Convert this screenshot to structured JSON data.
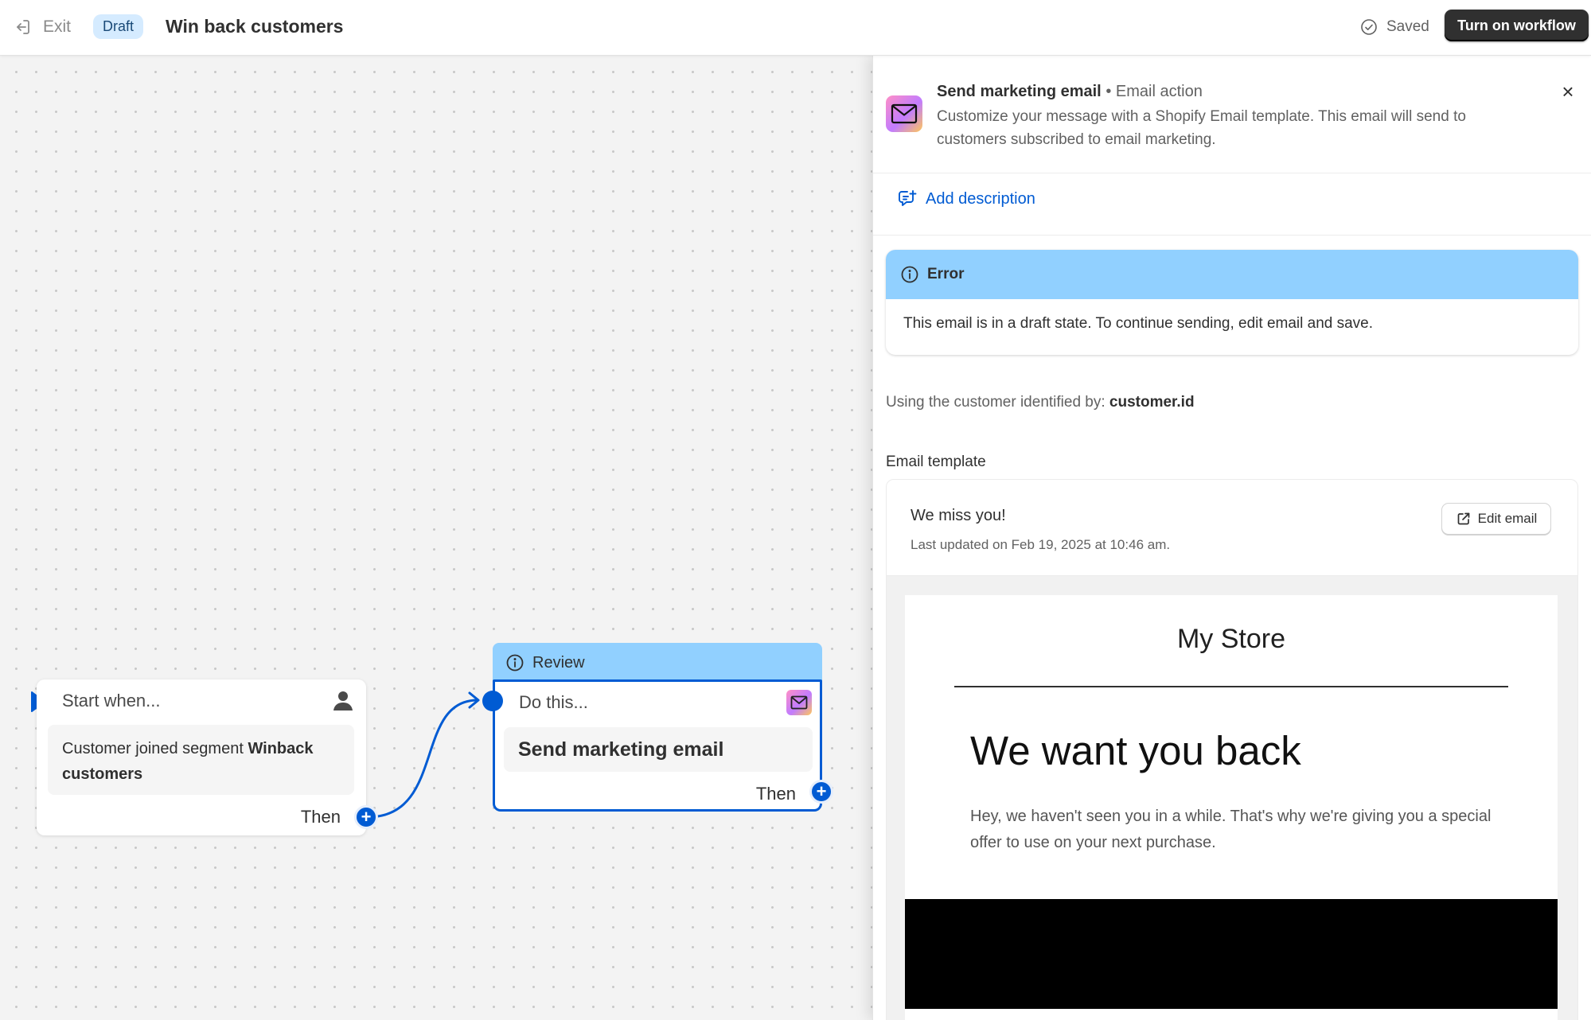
{
  "header": {
    "exit_label": "Exit",
    "status_badge": "Draft",
    "title": "Win back customers",
    "saved_label": "Saved",
    "primary_button": "Turn on workflow"
  },
  "canvas": {
    "trigger": {
      "heading": "Start when...",
      "body_prefix": "Customer joined segment ",
      "body_segment": "Winback customers",
      "then_label": "Then"
    },
    "action": {
      "status_label": "Review",
      "heading": "Do this...",
      "body": "Send marketing email",
      "then_label": "Then"
    }
  },
  "panel": {
    "title": "Send marketing email",
    "separator": "•",
    "kind": "Email action",
    "description": "Customize your message with a Shopify Email template. This email will send to customers subscribed to email marketing.",
    "add_description_label": "Add description",
    "error": {
      "title": "Error",
      "message": "This email is in a draft state. To continue sending, edit email and save."
    },
    "customer_prefix": "Using the customer identified by: ",
    "customer_field": "customer.id",
    "template_label": "Email template",
    "template": {
      "name": "We miss you!",
      "updated": "Last updated on Feb 19, 2025 at 10:46 am.",
      "edit_label": "Edit email"
    },
    "preview": {
      "store_name": "My Store",
      "headline": "We want you back",
      "body": "Hey, we haven't seen you in a while. That's why we're giving you a special offer to use on your next purchase."
    },
    "close_glyph": "×"
  },
  "colors": {
    "accent": "#005bd3",
    "status_info": "#91d0ff",
    "primary_button_bg": "#303030",
    "badge_bg": "#d5ebff"
  },
  "icons": [
    "exit-icon",
    "check-circle-icon",
    "person-icon",
    "mail-icon",
    "info-icon",
    "add-description-icon",
    "external-link-icon",
    "close-icon",
    "plus-icon"
  ]
}
